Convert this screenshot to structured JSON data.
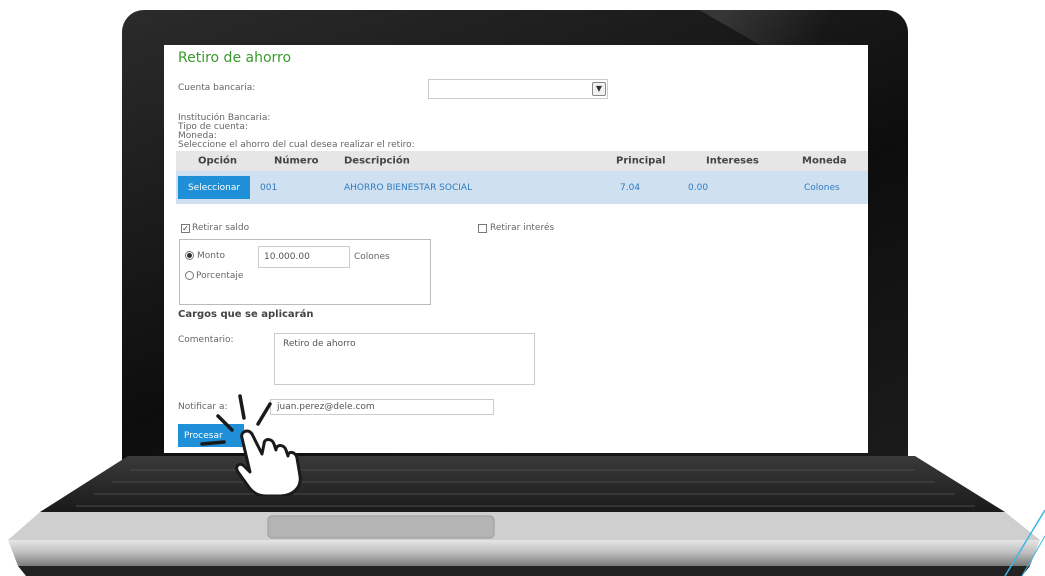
{
  "page": {
    "title": "Retiro de ahorro"
  },
  "account": {
    "label": "Cuenta bancaria:",
    "value": "",
    "arrow_icon": "chevron-down-icon"
  },
  "info_labels": {
    "institution": "Institución Bancaria:",
    "account_type": "Tipo de cuenta:",
    "currency": "Moneda:",
    "instruction": "Seleccione el ahorro del cual desea realizar el retiro:"
  },
  "table": {
    "columns": [
      "Opción",
      "Número",
      "Descripción",
      "Principal",
      "Intereses",
      "Moneda"
    ],
    "rows": [
      {
        "button_label": "Seleccionar",
        "number": "001",
        "description": "AHORRO BIENESTAR SOCIAL",
        "principal": "7.04",
        "interest": "0.00",
        "currency": "Colones"
      }
    ]
  },
  "withdraw": {
    "balance_label": "Retirar saldo",
    "balance_checked": true,
    "interest_label": "Retirar interés",
    "interest_checked": false,
    "amount_label": "Monto",
    "amount_selected": true,
    "amount_value": "10.000.00",
    "amount_currency": "Colones",
    "percentage_label": "Porcentaje"
  },
  "charges": {
    "title": "Cargos que se aplicarán"
  },
  "comment": {
    "label": "Comentario:",
    "value": "Retiro de ahorro"
  },
  "notify": {
    "label": "Notificar a:",
    "value": "juan.perez@dele.com"
  },
  "actions": {
    "process_label": "Procesar"
  },
  "decor": {
    "hand_icon": "pointing-hand-click-icon",
    "accent_color": "#1f8fd8",
    "title_color": "#3a9a2e"
  }
}
